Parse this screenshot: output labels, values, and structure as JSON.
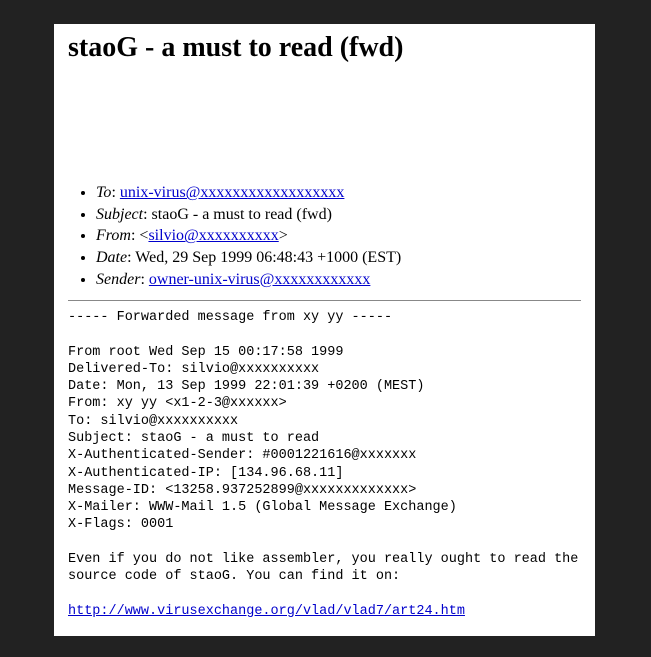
{
  "title": "staoG - a must to read (fwd)",
  "headers": {
    "to_label": "To",
    "to_value": "unix-virus@xxxxxxxxxxxxxxxxxx",
    "subject_label": "Subject",
    "subject_value": "staoG - a must to read (fwd)",
    "from_label": "From",
    "from_prefix": "<",
    "from_value": "silvio@xxxxxxxxxx",
    "from_suffix": ">",
    "date_label": "Date",
    "date_value": "Wed, 29 Sep 1999 06:48:43 +1000 (EST)",
    "sender_label": "Sender",
    "sender_value": "owner-unix-virus@xxxxxxxxxxxx"
  },
  "body": {
    "pre": "----- Forwarded message from xy yy -----\n\nFrom root Wed Sep 15 00:17:58 1999\nDelivered-To: silvio@xxxxxxxxxx\nDate: Mon, 13 Sep 1999 22:01:39 +0200 (MEST)\nFrom: xy yy <x1-2-3@xxxxxx>\nTo: silvio@xxxxxxxxxx\nSubject: staoG - a must to read\nX-Authenticated-Sender: #0001221616@xxxxxxx\nX-Authenticated-IP: [134.96.68.11]\nMessage-ID: <13258.937252899@xxxxxxxxxxxxx>\nX-Mailer: WWW-Mail 1.5 (Global Message Exchange)\nX-Flags: 0001\n\nEven if you do not like assembler, you really ought to read the\nsource code of staoG. You can find it on:\n\n",
    "link": "http://www.virusexchange.org/vlad/vlad7/art24.htm"
  }
}
